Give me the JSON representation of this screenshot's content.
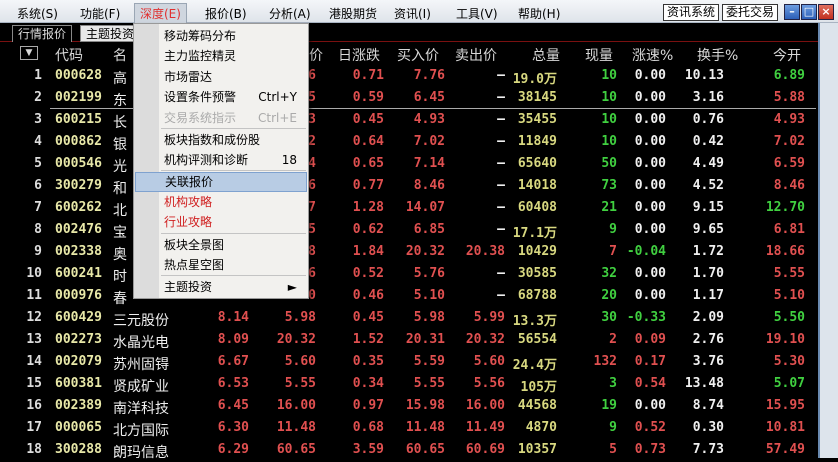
{
  "menubar": {
    "items": [
      "系统(S)",
      "功能(F)",
      "深度(E)",
      "报价(B)",
      "分析(A)",
      "港股期货",
      "资讯(I)",
      "工具(V)",
      "帮助(H)"
    ],
    "buttons": [
      "资讯系统",
      "委托交易"
    ],
    "window_controls": [
      "minimize-icon",
      "maximize-icon",
      "close-icon"
    ]
  },
  "tabs": [
    "行情报价",
    "主题投资"
  ],
  "header": {
    "dropdown": "▼",
    "cols": [
      "代码",
      "名",
      "价",
      "日涨跌",
      "买入价",
      "卖出价",
      "总量",
      "现量",
      "涨速%",
      "换手%",
      "今开"
    ]
  },
  "menu": {
    "items": [
      {
        "label": "移动筹码分布",
        "shortcut": "",
        "state": "normal"
      },
      {
        "label": "主力监控精灵",
        "shortcut": "",
        "state": "normal"
      },
      {
        "label": "市场雷达",
        "shortcut": "",
        "state": "normal"
      },
      {
        "label": "设置条件预警",
        "shortcut": "Ctrl+Y",
        "state": "normal"
      },
      {
        "label": "交易系统指示",
        "shortcut": "Ctrl+E",
        "state": "disabled"
      },
      {
        "label": "板块指数和成份股",
        "shortcut": "",
        "state": "normal"
      },
      {
        "label": "机构评测和诊断",
        "shortcut": "18",
        "state": "normal"
      },
      {
        "label": "关联报价",
        "shortcut": "",
        "state": "highlighted"
      },
      {
        "label": "机构攻略",
        "shortcut": "",
        "state": "red"
      },
      {
        "label": "行业攻略",
        "shortcut": "",
        "state": "red"
      },
      {
        "label": "板块全景图",
        "shortcut": "",
        "state": "normal"
      },
      {
        "label": "热点星空图",
        "shortcut": "",
        "state": "normal"
      },
      {
        "label": "主题投资",
        "shortcut": "►",
        "state": "normal"
      }
    ]
  },
  "colors": {
    "up": "#e05050",
    "down": "#40d040"
  },
  "rows": [
    {
      "n": "1",
      "code": "000628",
      "name": "高",
      "pct": "",
      "price": "6",
      "chg": "0.71",
      "bid": "7.76",
      "ask": "—",
      "vol": "19.0万",
      "cv": "10",
      "cvc": "down",
      "spd": "0.00",
      "to": "10.13",
      "open": "6.89",
      "oc": "down"
    },
    {
      "n": "2",
      "code": "002199",
      "name": "东",
      "pct": "",
      "price": "5",
      "chg": "0.59",
      "bid": "6.45",
      "ask": "—",
      "vol": "38145",
      "cv": "10",
      "cvc": "down",
      "spd": "0.00",
      "to": "3.16",
      "open": "5.88",
      "oc": "up"
    },
    {
      "n": "3",
      "code": "600215",
      "name": "长",
      "pct": "",
      "price": "3",
      "chg": "0.45",
      "bid": "4.93",
      "ask": "—",
      "vol": "35455",
      "cv": "10",
      "cvc": "down",
      "spd": "0.00",
      "to": "0.76",
      "open": "4.93",
      "oc": "up"
    },
    {
      "n": "4",
      "code": "000862",
      "name": "银",
      "pct": "",
      "price": "2",
      "chg": "0.64",
      "bid": "7.02",
      "ask": "—",
      "vol": "11849",
      "cv": "10",
      "cvc": "down",
      "spd": "0.00",
      "to": "0.42",
      "open": "7.02",
      "oc": "up"
    },
    {
      "n": "5",
      "code": "000546",
      "name": "光",
      "pct": "",
      "price": "4",
      "chg": "0.65",
      "bid": "7.14",
      "ask": "—",
      "vol": "65640",
      "cv": "50",
      "cvc": "down",
      "spd": "0.00",
      "to": "4.49",
      "open": "6.59",
      "oc": "up"
    },
    {
      "n": "6",
      "code": "300279",
      "name": "和",
      "pct": "",
      "price": "6",
      "chg": "0.77",
      "bid": "8.46",
      "ask": "—",
      "vol": "14018",
      "cv": "73",
      "cvc": "down",
      "spd": "0.00",
      "to": "4.52",
      "open": "8.46",
      "oc": "up"
    },
    {
      "n": "7",
      "code": "600262",
      "name": "北",
      "pct": "",
      "price": "7",
      "chg": "1.28",
      "bid": "14.07",
      "ask": "—",
      "vol": "60408",
      "cv": "21",
      "cvc": "down",
      "spd": "0.00",
      "to": "9.15",
      "open": "12.70",
      "oc": "down"
    },
    {
      "n": "8",
      "code": "002476",
      "name": "宝",
      "pct": "",
      "price": "5",
      "chg": "0.62",
      "bid": "6.85",
      "ask": "—",
      "vol": "17.1万",
      "cv": "9",
      "cvc": "down",
      "spd": "0.00",
      "to": "9.65",
      "open": "6.81",
      "oc": "up"
    },
    {
      "n": "9",
      "code": "002338",
      "name": "奥",
      "pct": "",
      "price": "8",
      "chg": "1.84",
      "bid": "20.32",
      "ask": "20.38",
      "vol": "10429",
      "cv": "7",
      "cvc": "up",
      "spd": "-0.04",
      "to": "1.72",
      "open": "18.66",
      "oc": "up"
    },
    {
      "n": "10",
      "code": "600241",
      "name": "时",
      "pct": "",
      "price": "6",
      "chg": "0.52",
      "bid": "5.76",
      "ask": "—",
      "vol": "30585",
      "cv": "32",
      "cvc": "down",
      "spd": "0.00",
      "to": "1.70",
      "open": "5.55",
      "oc": "up"
    },
    {
      "n": "11",
      "code": "000976",
      "name": "春",
      "pct": "",
      "price": "0",
      "chg": "0.46",
      "bid": "5.10",
      "ask": "—",
      "vol": "68788",
      "cv": "20",
      "cvc": "down",
      "spd": "0.00",
      "to": "1.17",
      "open": "5.10",
      "oc": "up"
    },
    {
      "n": "12",
      "code": "600429",
      "name": "三元股份",
      "pct": "8.14",
      "price": "5.98",
      "chg": "0.45",
      "bid": "5.98",
      "ask": "5.99",
      "vol": "13.3万",
      "cv": "30",
      "cvc": "down",
      "spd": "-0.33",
      "to": "2.09",
      "open": "5.50",
      "oc": "down"
    },
    {
      "n": "13",
      "code": "002273",
      "name": "水晶光电",
      "pct": "8.09",
      "price": "20.32",
      "chg": "1.52",
      "bid": "20.31",
      "ask": "20.32",
      "vol": "56554",
      "cv": "2",
      "cvc": "up",
      "spd": "0.09",
      "to": "2.76",
      "open": "19.10",
      "oc": "up"
    },
    {
      "n": "14",
      "code": "002079",
      "name": "苏州固锝",
      "pct": "6.67",
      "price": "5.60",
      "chg": "0.35",
      "bid": "5.59",
      "ask": "5.60",
      "vol": "24.4万",
      "cv": "132",
      "cvc": "up",
      "spd": "0.17",
      "to": "3.76",
      "open": "5.30",
      "oc": "up"
    },
    {
      "n": "15",
      "code": "600381",
      "name": "贤成矿业",
      "pct": "6.53",
      "price": "5.55",
      "chg": "0.34",
      "bid": "5.55",
      "ask": "5.56",
      "vol": "105万",
      "cv": "3",
      "cvc": "down",
      "spd": "0.54",
      "to": "13.48",
      "open": "5.07",
      "oc": "down"
    },
    {
      "n": "16",
      "code": "002389",
      "name": "南洋科技",
      "pct": "6.45",
      "price": "16.00",
      "chg": "0.97",
      "bid": "15.98",
      "ask": "16.00",
      "vol": "44568",
      "cv": "19",
      "cvc": "down",
      "spd": "0.00",
      "to": "8.74",
      "open": "15.95",
      "oc": "up"
    },
    {
      "n": "17",
      "code": "000065",
      "name": "北方国际",
      "pct": "6.30",
      "price": "11.48",
      "chg": "0.68",
      "bid": "11.48",
      "ask": "11.49",
      "vol": "4870",
      "cv": "9",
      "cvc": "down",
      "spd": "0.52",
      "to": "0.30",
      "open": "10.81",
      "oc": "up"
    },
    {
      "n": "18",
      "code": "300288",
      "name": "朗玛信息",
      "pct": "6.29",
      "price": "60.65",
      "chg": "3.59",
      "bid": "60.65",
      "ask": "60.69",
      "vol": "10357",
      "cv": "5",
      "cvc": "up",
      "spd": "0.73",
      "to": "7.73",
      "open": "57.49",
      "oc": "up"
    }
  ]
}
